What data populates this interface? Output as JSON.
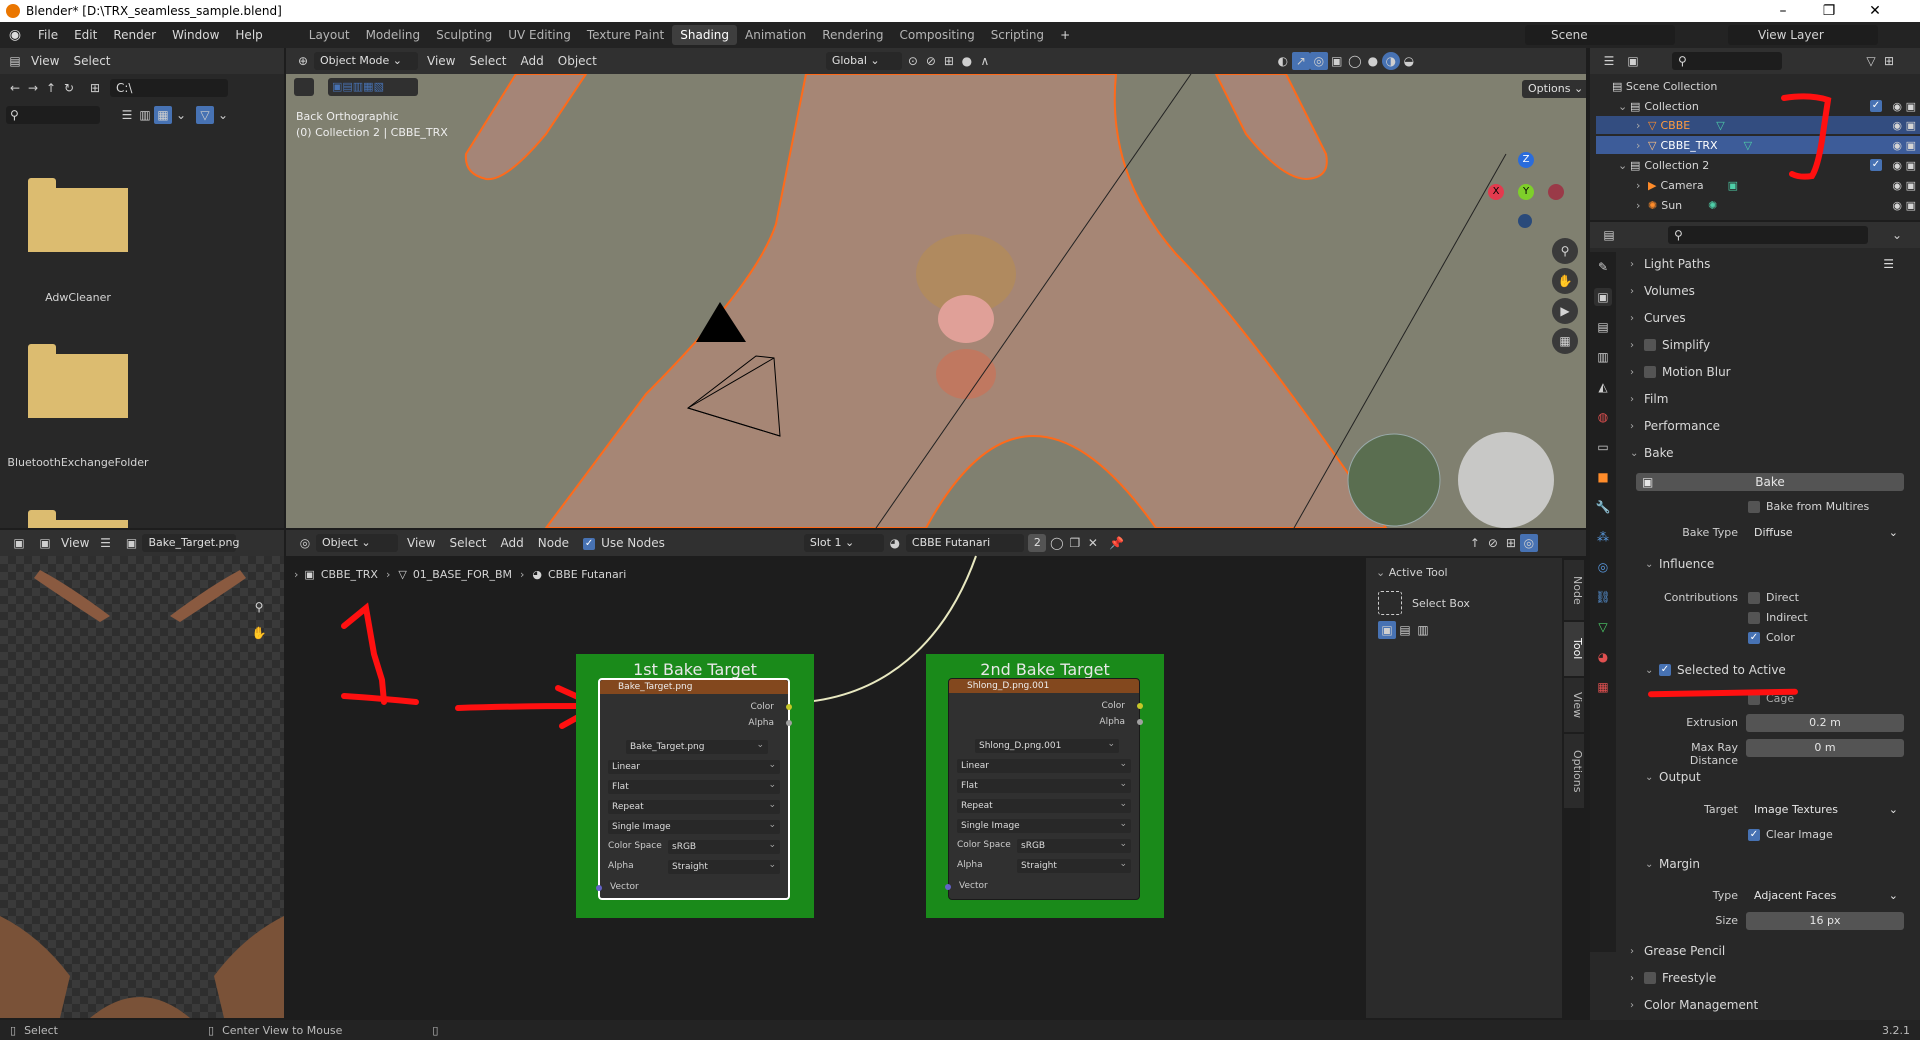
{
  "window": {
    "title": "Blender* [D:\\TRX_seamless_sample.blend]"
  },
  "menu": {
    "items": [
      "File",
      "Edit",
      "Render",
      "Window",
      "Help"
    ]
  },
  "workspaces": [
    "Layout",
    "Modeling",
    "Sculpting",
    "UV Editing",
    "Texture Paint",
    "Shading",
    "Animation",
    "Rendering",
    "Compositing",
    "Scripting"
  ],
  "active_workspace": "Shading",
  "scene": {
    "name": "Scene",
    "view_layer": "View Layer"
  },
  "file_browser": {
    "menu": [
      "View",
      "Select"
    ],
    "path": "C:\\",
    "folders": [
      "AdwCleaner",
      "BluetoothExchangeFolder"
    ]
  },
  "viewport": {
    "mode": "Object Mode",
    "menu": [
      "View",
      "Select",
      "Add",
      "Object"
    ],
    "orientation": "Global",
    "options": "Options",
    "info_line1": "Back Orthographic",
    "info_line2": "(0) Collection 2 | CBBE_TRX",
    "gizmo": {
      "z": "Z",
      "y": "Y",
      "x": "X"
    }
  },
  "image_editor": {
    "view": "View",
    "image": "Bake_Target.png"
  },
  "node_editor": {
    "type": "Object",
    "menu": [
      "View",
      "Select",
      "Add",
      "Node"
    ],
    "use_nodes": "Use Nodes",
    "slot": "Slot 1",
    "material": "CBBE Futanari",
    "users": "2",
    "breadcrumb": [
      "CBBE_TRX",
      "01_BASE_FOR_BM",
      "CBBE Futanari"
    ],
    "sidebar": {
      "title": "Active Tool",
      "tool": "Select Box",
      "tabs": [
        "Node",
        "Tool",
        "View",
        "Options"
      ]
    },
    "nodes": [
      {
        "frame": "1st Bake Target",
        "header": "Bake_Target.png",
        "image": "Bake_Target.png",
        "outputs": [
          "Color",
          "Alpha"
        ],
        "interp": "Linear",
        "proj": "Flat",
        "ext": "Repeat",
        "source": "Single Image",
        "cs_label": "Color Space",
        "cs": "sRGB",
        "alpha_label": "Alpha",
        "alpha": "Straight",
        "input": "Vector"
      },
      {
        "frame": "2nd Bake Target",
        "header": "Shlong_D.png.001",
        "image": "Shlong_D.png.001",
        "outputs": [
          "Color",
          "Alpha"
        ],
        "interp": "Linear",
        "proj": "Flat",
        "ext": "Repeat",
        "source": "Single Image",
        "cs_label": "Color Space",
        "cs": "sRGB",
        "alpha_label": "Alpha",
        "alpha": "Straight",
        "input": "Vector"
      }
    ],
    "annotation": "1"
  },
  "outliner": {
    "root": "Scene Collection",
    "items": [
      {
        "name": "Collection",
        "level": 1
      },
      {
        "name": "CBBE",
        "level": 2
      },
      {
        "name": "CBBE_TRX",
        "level": 2
      },
      {
        "name": "Collection 2",
        "level": 1
      },
      {
        "name": "Camera",
        "level": 2
      },
      {
        "name": "Sun",
        "level": 2
      }
    ]
  },
  "properties": {
    "panels_top": [
      "Light Paths",
      "Volumes",
      "Curves",
      "Simplify",
      "Motion Blur",
      "Film",
      "Performance"
    ],
    "bake": {
      "title": "Bake",
      "button": "Bake",
      "from_multires": "Bake from Multires",
      "type_label": "Bake Type",
      "type": "Diffuse",
      "influence": "Influence",
      "contributions": "Contributions",
      "direct": "Direct",
      "indirect": "Indirect",
      "color": "Color",
      "selected_to_active": "Selected to Active",
      "cage": "Cage",
      "extrusion_label": "Extrusion",
      "extrusion": "0.2 m",
      "ray_label": "Max Ray Distance",
      "ray": "0 m",
      "output": "Output",
      "target_label": "Target",
      "target": "Image Textures",
      "clear_image": "Clear Image",
      "margin": "Margin",
      "mtype_label": "Type",
      "mtype": "Adjacent Faces",
      "size_label": "Size",
      "size": "16 px"
    },
    "panels_bottom": [
      "Grease Pencil",
      "Freestyle",
      "Color Management"
    ]
  },
  "status": {
    "left": "Select",
    "mid": "Center View to Mouse",
    "version": "3.2.1"
  },
  "colors": {
    "accent": "#4772b3",
    "frame_green": "#1a8a1a",
    "node_header": "#83481e",
    "annotation_red": "#ff1010"
  }
}
